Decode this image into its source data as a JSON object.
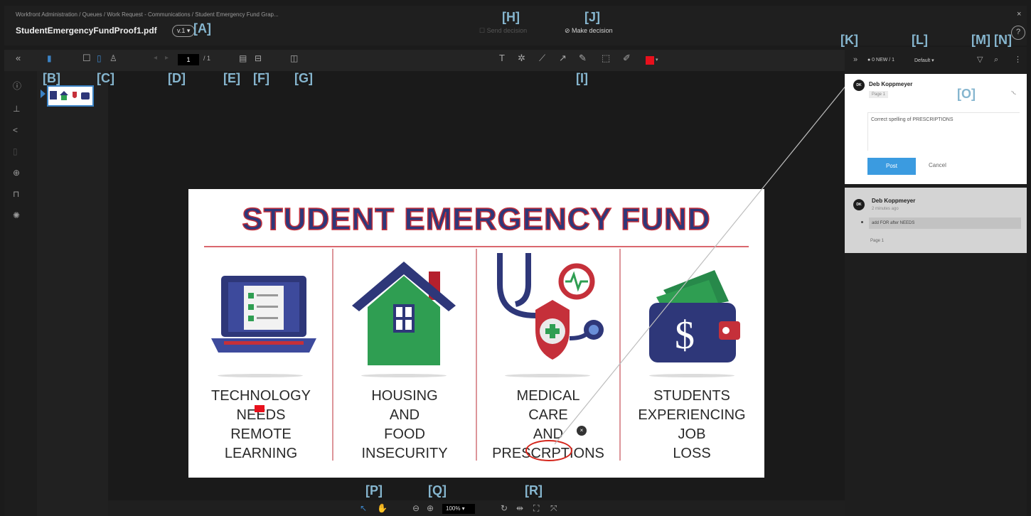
{
  "header": {
    "breadcrumb": "Workfront Administration / Queues / Work Request - Communications / Student Emergency Fund Grap...",
    "filename": "StudentEmergencyFundProof1.pdf",
    "version": "v.1 ▾",
    "send_label": "☐ Send decision",
    "decision_label": "Make decision",
    "close_glyph": "×",
    "help_glyph": "?"
  },
  "toolbar": {
    "page_current": "1",
    "page_total": "/ 1",
    "annotation_color": "#e8101c",
    "icons": [
      "collapse-icon",
      "thumbnail-view-icon",
      "single-page-icon",
      "two-page-icon",
      "person-icon",
      "prev-page-icon",
      "next-page-icon",
      "fit-page-icon",
      "find-icon",
      "compare-icon",
      "text-tool-icon",
      "pin-tool-icon",
      "line-tool-icon",
      "arrow-tool-icon",
      "pen-tool-icon",
      "rectangle-tool-icon",
      "highlight-tool-icon"
    ]
  },
  "left_rail": {
    "icons": [
      "info-icon",
      "workflow-icon",
      "share-icon",
      "phone-icon",
      "globe-icon",
      "lock-icon",
      "settings-icon"
    ]
  },
  "document": {
    "title": "STUDENT EMERGENCY FUND",
    "columns": [
      {
        "line1": "TECHNOLOGY",
        "line2": "NEEDS",
        "line3": "REMOTE",
        "line4": "LEARNING",
        "icon": "laptop-icon"
      },
      {
        "line1": "HOUSING",
        "line2": "AND",
        "line3": "FOOD",
        "line4": "INSECURITY",
        "icon": "house-icon"
      },
      {
        "line1": "MEDICAL",
        "line2": "CARE",
        "line3": "AND",
        "line4": "PRESCRPTIONS",
        "icon": "medical-shield-icon"
      },
      {
        "line1": "STUDENTS",
        "line2": "EXPERIENCING",
        "line3": "JOB",
        "line4": "LOSS",
        "icon": "wallet-icon"
      }
    ],
    "colors": {
      "navy": "#2e3779",
      "red": "#c5303a",
      "green": "#2f9e52"
    }
  },
  "bottom_bar": {
    "zoom": "100% ▾",
    "icons": [
      "select-tool-icon",
      "hand-tool-icon",
      "zoom-out-icon",
      "zoom-in-icon",
      "rotate-icon",
      "fit-width-icon",
      "fit-screen-icon",
      "fullscreen-icon"
    ]
  },
  "comments_panel": {
    "count_label": "● 0 NEW / 1",
    "sort_label": "Default",
    "card1": {
      "author": "Deb Koppmeyer",
      "initials": "DK",
      "page": "Page 1",
      "text": "Correct spelling of PRESCRIPTIONS",
      "post_label": "Post",
      "cancel_label": "Cancel"
    },
    "card2": {
      "author": "Deb Koppmeyer",
      "initials": "DK",
      "time": "2 minutes ago",
      "reply": "add FOR after NEEDS",
      "page": "Page 1"
    }
  },
  "callouts": {
    "A": "[A]",
    "B": "[B]",
    "C": "[C]",
    "D": "[D]",
    "E": "[E]",
    "F": "[F]",
    "G": "[G]",
    "H": "[H]",
    "I": "[I]",
    "J": "[J]",
    "K": "[K]",
    "L": "[L]",
    "M": "[M]",
    "N": "[N]",
    "O": "[O]",
    "P": "[P]",
    "Q": "[Q]",
    "R": "[R]"
  }
}
